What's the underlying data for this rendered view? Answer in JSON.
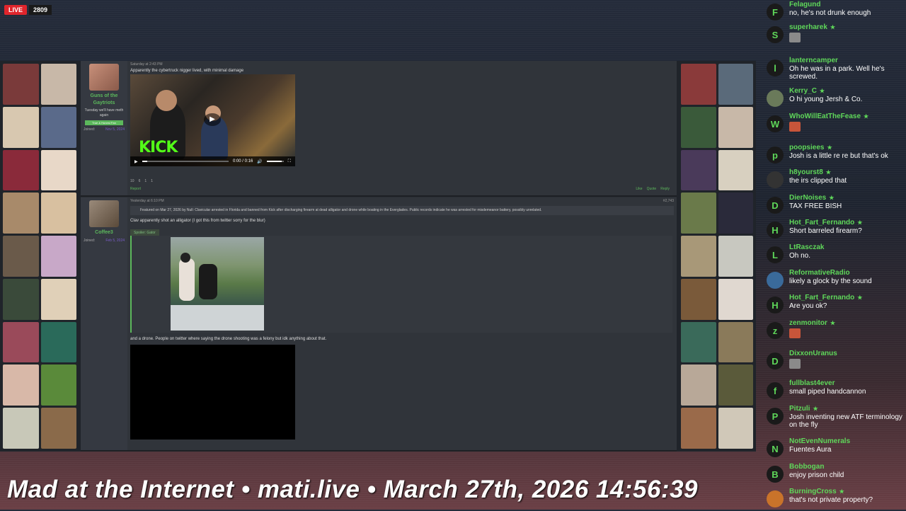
{
  "live": {
    "label": "LIVE",
    "viewers": "2809"
  },
  "post1": {
    "header": "Saturday at 2:43 PM",
    "text": "Apparently the cybertruck nigger lived, with minimal damage",
    "author": "Guns of the Gaytriots",
    "author_title": "Tuesday we'll have meth again",
    "badge": "True & Honest Fan",
    "joined_label": "Joined:",
    "joined_date": "Nov 5, 2024",
    "watermark": "KICK",
    "time": "0:00 / 0:16",
    "report": "Report",
    "reactions": [
      "10",
      "6",
      "1",
      "1"
    ],
    "actions": [
      "Like",
      "Quote",
      "Reply"
    ]
  },
  "post2": {
    "header": "Yesterday at 6:10 PM",
    "post_no": "#2,743",
    "featured": "Featured on Mar 27, 2026 by Null: Clavicular arrested in Florida and banned from Kick after discharging firearm at dead alligator and drone while boating in the Everglades. Public records indicate he was arrested for misdemeanor battery, possibly unrelated.",
    "text1": "Clav apparently shot an alligator (I got this from twitter sorry for the blur)",
    "spoiler": "Spoiler: Gator",
    "text2": "and a drone. People on twitter where saying the drone shooting was a felony but idk anything about that.",
    "author": "Coffee3",
    "joined_label": "Joined:",
    "joined_date": "Feb 5, 2024"
  },
  "chat": [
    {
      "user": "Felagund",
      "text": "no, he's not drunk enough",
      "initial": "F",
      "star": false,
      "emote": false,
      "color": "#1a1a1a"
    },
    {
      "user": "superharek",
      "text": "",
      "initial": "S",
      "star": true,
      "emote": true,
      "color": "#1a1a1a"
    },
    {
      "user": "lanterncamper",
      "text": "Oh he was in a park. Well he's screwed.",
      "initial": "l",
      "star": false,
      "emote": false,
      "color": "#1a1a1a"
    },
    {
      "user": "Kerry_C",
      "text": "O hi young Jersh & Co.",
      "initial": "",
      "star": true,
      "emote": false,
      "color": "#6a7a5a"
    },
    {
      "user": "WhoWillEatTheFease",
      "text": "",
      "initial": "W",
      "star": true,
      "emote": true,
      "color": "#1a1a1a"
    },
    {
      "user": "poopsiees",
      "text": "Josh is a little re re but that's ok",
      "initial": "p",
      "star": true,
      "emote": false,
      "color": "#1a1a1a"
    },
    {
      "user": "h8yourst8",
      "text": "the irs clipped that",
      "initial": "",
      "star": true,
      "emote": false,
      "color": "#333"
    },
    {
      "user": "DierNoises",
      "text": "TAX FREE BISH",
      "initial": "D",
      "star": true,
      "emote": false,
      "color": "#1a1a1a"
    },
    {
      "user": "Hot_Fart_Fernando",
      "text": "Short barreled firearm?",
      "initial": "H",
      "star": true,
      "emote": false,
      "color": "#1a1a1a"
    },
    {
      "user": "LtRasczak",
      "text": "Oh no.",
      "initial": "L",
      "star": false,
      "emote": false,
      "color": "#1a1a1a"
    },
    {
      "user": "ReformativeRadio",
      "text": "likely a glock by the sound",
      "initial": "",
      "star": false,
      "emote": false,
      "color": "#3a6a9a"
    },
    {
      "user": "Hot_Fart_Fernando",
      "text": "Are you ok?",
      "initial": "H",
      "star": true,
      "emote": false,
      "color": "#1a1a1a"
    },
    {
      "user": "zenmonitor",
      "text": "",
      "initial": "z",
      "star": true,
      "emote": true,
      "color": "#1a1a1a"
    },
    {
      "user": "DixxonUranus",
      "text": "",
      "initial": "D",
      "star": false,
      "emote": true,
      "color": "#1a1a1a"
    },
    {
      "user": "fullblast4ever",
      "text": "small piped handcannon",
      "initial": "f",
      "star": false,
      "emote": false,
      "color": "#1a1a1a"
    },
    {
      "user": "Pitzuli",
      "text": "Josh inventing new ATF terminology on the fly",
      "initial": "P",
      "star": true,
      "emote": false,
      "color": "#1a1a1a"
    },
    {
      "user": "NotEvenNumerals",
      "text": "Fuentes Aura",
      "initial": "N",
      "star": false,
      "emote": false,
      "color": "#1a1a1a"
    },
    {
      "user": "Bobbogan",
      "text": "enjoy prison child",
      "initial": "B",
      "star": false,
      "emote": false,
      "color": "#1a1a1a"
    },
    {
      "user": "BurningCross",
      "text": "that's not private property?",
      "initial": "",
      "star": true,
      "emote": false,
      "color": "#c9732a"
    }
  ],
  "footer": "Mad at the Internet • mati.live • March 27th, 2026 14:56:39",
  "colors": {
    "accent": "#5fd85a",
    "live": "#e0252c"
  }
}
